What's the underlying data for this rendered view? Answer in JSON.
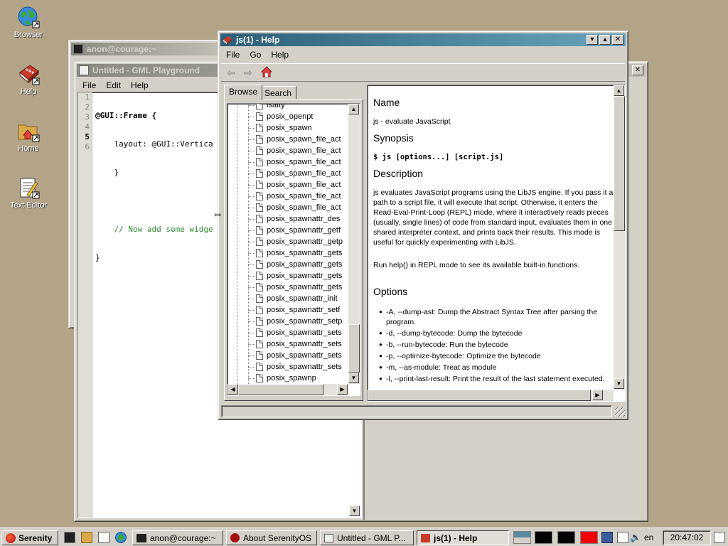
{
  "desktop": {
    "icons": [
      {
        "label": "Browser",
        "icon": "globe-icon"
      },
      {
        "label": "Help",
        "icon": "help-book-icon"
      },
      {
        "label": "Home",
        "icon": "home-folder-icon"
      },
      {
        "label": "Text Editor",
        "icon": "text-editor-icon"
      }
    ]
  },
  "terminal": {
    "title": "anon@courage:~"
  },
  "gml": {
    "title": "Untitled - GML Playground",
    "menu": [
      "File",
      "Edit",
      "Help"
    ],
    "line_numbers": [
      "1",
      "2",
      "3",
      "4",
      "5",
      "6"
    ],
    "code": [
      "@GUI::Frame {",
      "    layout: @GUI::Vertica",
      "    }",
      "",
      "    // Now add some widge",
      "}"
    ]
  },
  "help": {
    "title": "js(1) - Help",
    "menu": [
      "File",
      "Go",
      "Help"
    ],
    "tabs": [
      "Browse",
      "Search"
    ],
    "tree_items": [
      "isatty",
      "posix_openpt",
      "posix_spawn",
      "posix_spawn_file_act",
      "posix_spawn_file_act",
      "posix_spawn_file_act",
      "posix_spawn_file_act",
      "posix_spawn_file_act",
      "posix_spawn_file_act",
      "posix_spawn_file_act",
      "posix_spawnattr_des",
      "posix_spawnattr_getf",
      "posix_spawnattr_getp",
      "posix_spawnattr_gets",
      "posix_spawnattr_gets",
      "posix_spawnattr_gets",
      "posix_spawnattr_gets",
      "posix_spawnattr_init",
      "posix_spawnattr_setf",
      "posix_spawnattr_setp",
      "posix_spawnattr_sets",
      "posix_spawnattr_sets",
      "posix_spawnattr_sets",
      "posix_spawnattr_sets",
      "posix_spawnp"
    ],
    "doc": {
      "name_heading": "Name",
      "name_text": "js - evaluate JavaScript",
      "synopsis_heading": "Synopsis",
      "synopsis_text": "$ js [options...] [script.js]",
      "description_heading": "Description",
      "description_p1": "js evaluates JavaScript programs using the LibJS engine. If you pass it a path to a script file, it will execute that script. Otherwise, it enters the Read-Eval-Print-Loop (REPL) mode, where it interactively reads pieces (usually, single lines) of code from standard input, evaluates them in one shared interpreter context, and prints back their results. This mode is useful for quickly experimenting with LibJS.",
      "description_p2": "Run help() in REPL mode to see its available built-in functions.",
      "options_heading": "Options",
      "options": [
        "-A, --dump-ast: Dump the Abstract Syntax Tree after parsing the program.",
        "-d, --dump-bytecode: Dump the bytecode",
        "-b, --run-bytecode: Run the bytecode",
        "-p, --optimize-bytecode: Optimize the bytecode",
        "-m, --as-module: Treat as module",
        "-l, --print-last-result: Print the result of the last statement executed."
      ]
    }
  },
  "taskbar": {
    "start_label": "Serenity",
    "tasks": [
      {
        "label": "anon@courage:~",
        "active": false
      },
      {
        "label": "About SerenityOS",
        "active": false
      },
      {
        "label": "Untitled - GML P...",
        "active": false
      },
      {
        "label": "js(1) - Help",
        "active": true
      }
    ],
    "keyboard_layout": "en",
    "clock": "20:47:02",
    "colors": {
      "desktop": "#b3a488",
      "active_title": "#2d5f78"
    }
  }
}
